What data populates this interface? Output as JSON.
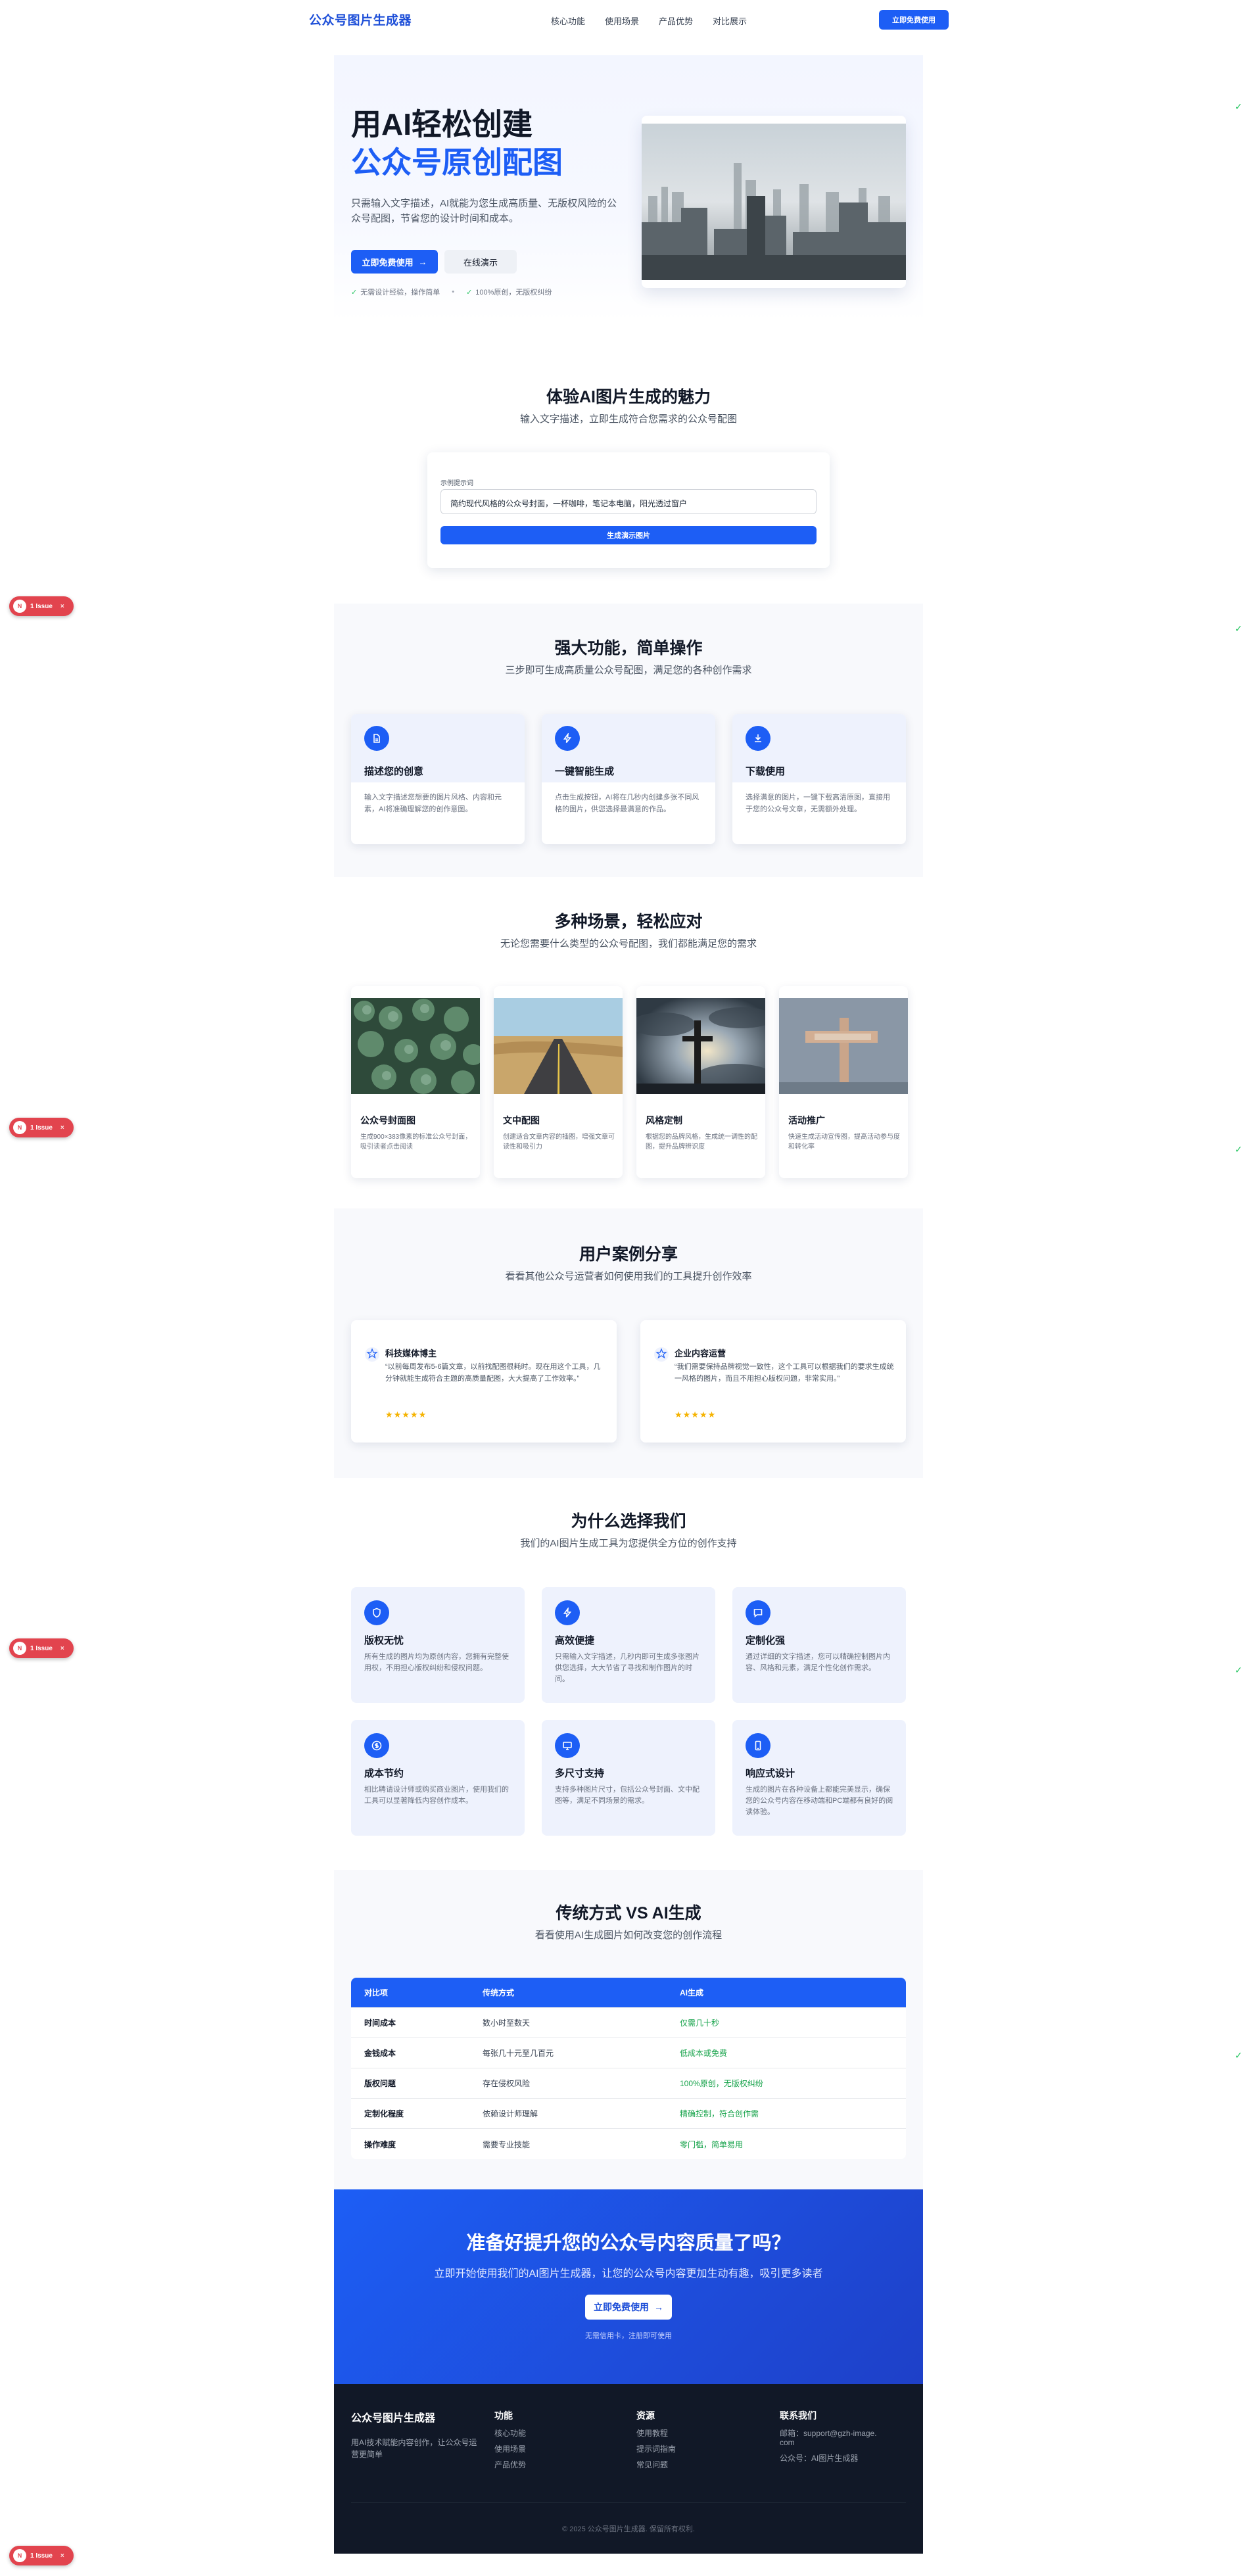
{
  "nav": {
    "brand": "公众号图片生成器",
    "links": [
      "核心功能",
      "使用场景",
      "产品优势",
      "对比展示"
    ],
    "cta": "立即免费使用"
  },
  "hero": {
    "title_line1": "用AI轻松创建",
    "title_line2": "公众号原创配图",
    "subtitle": "只需输入文字描述，AI就能为您生成高质量、无版权风险的公众号配图，节省您的设计时间和成本。",
    "primary_button": "立即免费使用",
    "secondary_button": "在线演示",
    "checks": [
      "无需设计经验，操作简单",
      "100%原创，无版权纠纷"
    ]
  },
  "demo": {
    "title": "体验AI图片生成的魅力",
    "subtitle": "输入文字描述，立即生成符合您需求的公众号配图",
    "input_label": "示例提示词",
    "input_value": "简约现代风格的公众号封面，一杯咖啡，笔记本电脑，阳光透过窗户",
    "button": "生成演示图片"
  },
  "features": {
    "title": "强大功能，简单操作",
    "subtitle": "三步即可生成高质量公众号配图，满足您的各种创作需求",
    "items": [
      {
        "icon": "doc-icon",
        "title": "描述您的创意",
        "desc": "输入文字描述您想要的图片风格、内容和元素，AI将准确理解您的创作意图。"
      },
      {
        "icon": "bolt-icon",
        "title": "一键智能生成",
        "desc": "点击生成按钮，AI将在几秒内创建多张不同风格的图片，供您选择最满意的作品。"
      },
      {
        "icon": "download-icon",
        "title": "下载使用",
        "desc": "选择满意的图片，一键下载高清原图，直接用于您的公众号文章，无需额外处理。"
      }
    ]
  },
  "scenes": {
    "title": "多种场景，轻松应对",
    "subtitle": "无论您需要什么类型的公众号配图，我们都能满足您的需求",
    "items": [
      {
        "title": "公众号封面图",
        "desc": "生成900×383像素的标准公众号封面，吸引读者点击阅读"
      },
      {
        "title": "文中配图",
        "desc": "创建适合文章内容的插图，增强文章可读性和吸引力"
      },
      {
        "title": "风格定制",
        "desc": "根据您的品牌风格，生成统一调性的配图，提升品牌辨识度"
      },
      {
        "title": "活动推广",
        "desc": "快速生成活动宣传图，提高活动参与度和转化率"
      }
    ]
  },
  "cases": {
    "title": "用户案例分享",
    "subtitle": "看看其他公众号运营者如何使用我们的工具提升创作效率",
    "items": [
      {
        "name": "科技媒体博主",
        "quote": "“以前每周发布5-6篇文章，以前找配图很耗时。现在用这个工具，几分钟就能生成符合主题的高质量配图，大大提高了工作效率。”",
        "stars": "★★★★★"
      },
      {
        "name": "企业内容运营",
        "quote": "“我们需要保持品牌视觉一致性，这个工具可以根据我们的要求生成统一风格的图片，而且不用担心版权问题，非常实用。”",
        "stars": "★★★★★"
      }
    ]
  },
  "why": {
    "title": "为什么选择我们",
    "subtitle": "我们的AI图片生成工具为您提供全方位的创作支持",
    "items": [
      {
        "icon": "shield-icon",
        "title": "版权无忧",
        "desc": "所有生成的图片均为原创内容，您拥有完整使用权，不用担心版权纠纷和侵权问题。"
      },
      {
        "icon": "bolt-icon",
        "title": "高效便捷",
        "desc": "只需输入文字描述，几秒内即可生成多张图片供您选择，大大节省了寻找和制作图片的时间。"
      },
      {
        "icon": "chat-icon",
        "title": "定制化强",
        "desc": "通过详细的文字描述，您可以精确控制图片内容、风格和元素，满足个性化创作需求。"
      },
      {
        "icon": "dollar-icon",
        "title": "成本节约",
        "desc": "相比聘请设计师或购买商业图片，使用我们的工具可以显著降低内容创作成本。"
      },
      {
        "icon": "monitor-icon",
        "title": "多尺寸支持",
        "desc": "支持多种图片尺寸，包括公众号封面、文中配图等，满足不同场景的需求。"
      },
      {
        "icon": "phone-icon",
        "title": "响应式设计",
        "desc": "生成的图片在各种设备上都能完美显示，确保您的公众号内容在移动端和PC端都有良好的阅读体验。"
      }
    ]
  },
  "compare": {
    "title": "传统方式 VS AI生成",
    "subtitle": "看看使用AI生成图片如何改变您的创作流程",
    "headers": [
      "对比项",
      "传统方式",
      "AI生成"
    ],
    "rows": [
      [
        "时间成本",
        "数小时至数天",
        "仅需几十秒"
      ],
      [
        "金钱成本",
        "每张几十元至几百元",
        "低成本或免费"
      ],
      [
        "版权问题",
        "存在侵权风险",
        "100%原创，无版权纠纷"
      ],
      [
        "定制化程度",
        "依赖设计师理解",
        "精确控制，符合创作需"
      ],
      [
        "操作难度",
        "需要专业技能",
        "零门槛，简单易用"
      ]
    ]
  },
  "cta": {
    "title": "准备好提升您的公众号内容质量了吗？",
    "subtitle": "立即开始使用我们的AI图片生成器，让您的公众号内容更加生动有趣，吸引更多读者",
    "button": "立即免费使用",
    "note": "无需信用卡，注册即可使用"
  },
  "footer": {
    "brand": "公众号图片生成器",
    "desc": "用AI技术赋能内容创作，让公众号运营更简单",
    "columns": [
      {
        "title": "功能",
        "items": [
          "核心功能",
          "使用场景",
          "产品优势"
        ]
      },
      {
        "title": "资源",
        "items": [
          "使用教程",
          "提示词指南",
          "常见问题"
        ]
      },
      {
        "title": "联系我们",
        "items": [
          "邮箱：support@gzh-image.com",
          "公众号：AI图片生成器"
        ]
      }
    ],
    "copyright": "© 2025 公众号图片生成器. 保留所有权利."
  },
  "issues": {
    "label": "1 Issue"
  },
  "colors": {
    "primary": "#1d5ef5",
    "dark": "#111827",
    "success": "#16a34a",
    "issue": "#e2444e"
  }
}
